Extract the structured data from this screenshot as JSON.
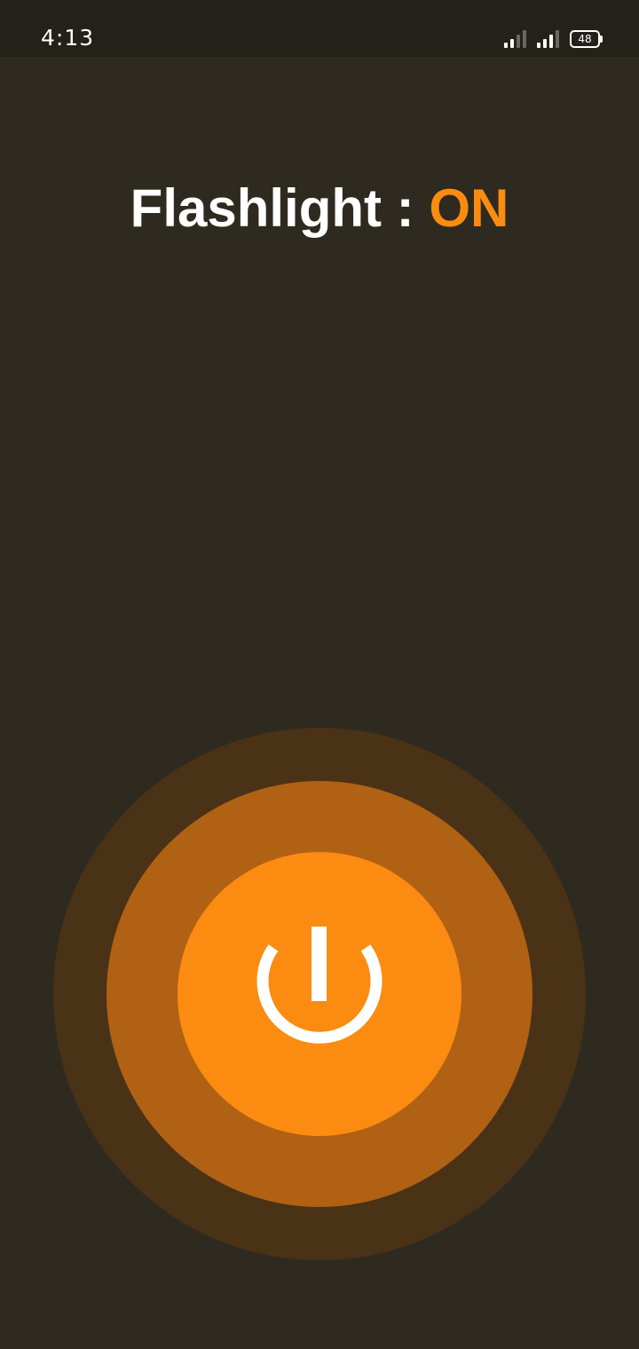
{
  "status_bar": {
    "time": "4:13",
    "battery_level": "48",
    "signal_icons": [
      "signal-icon",
      "signal-icon"
    ],
    "battery_icon": "battery-icon"
  },
  "header": {
    "label": "Flashlight : ",
    "state": "ON"
  },
  "power_button": {
    "icon": "power-icon",
    "state": "on"
  },
  "colors": {
    "background": "#2f2a20",
    "status_bar": "#24211b",
    "accent": "#fc8b12",
    "ring_middle": "#b06113",
    "ring_outer": "#4a3217",
    "text": "#ffffff"
  }
}
